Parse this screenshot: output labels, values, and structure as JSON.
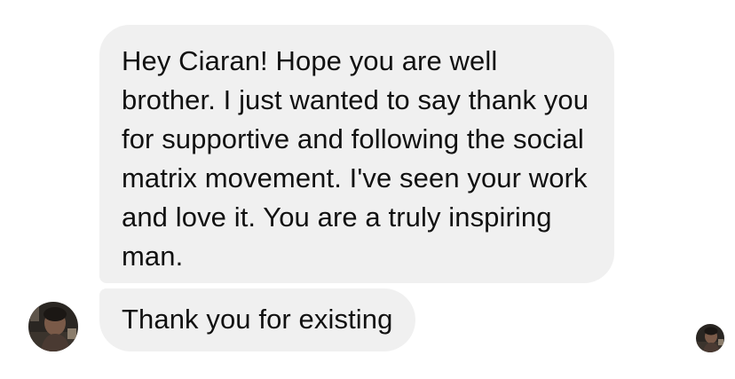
{
  "conversation": {
    "messages": [
      {
        "text": "Hey Ciaran! Hope you are well brother. I just wanted to say thank you for supportive and following the social matrix movement. I've seen your work and love it. You are a truly inspiring man."
      },
      {
        "text": "Thank you for existing"
      }
    ],
    "sender_avatar_icon": "user-photo-avatar",
    "read_receipt_icon": "seen-avatar",
    "colors": {
      "bubble_background": "#f0f0f0",
      "text": "#111111",
      "page_background": "#ffffff"
    }
  }
}
